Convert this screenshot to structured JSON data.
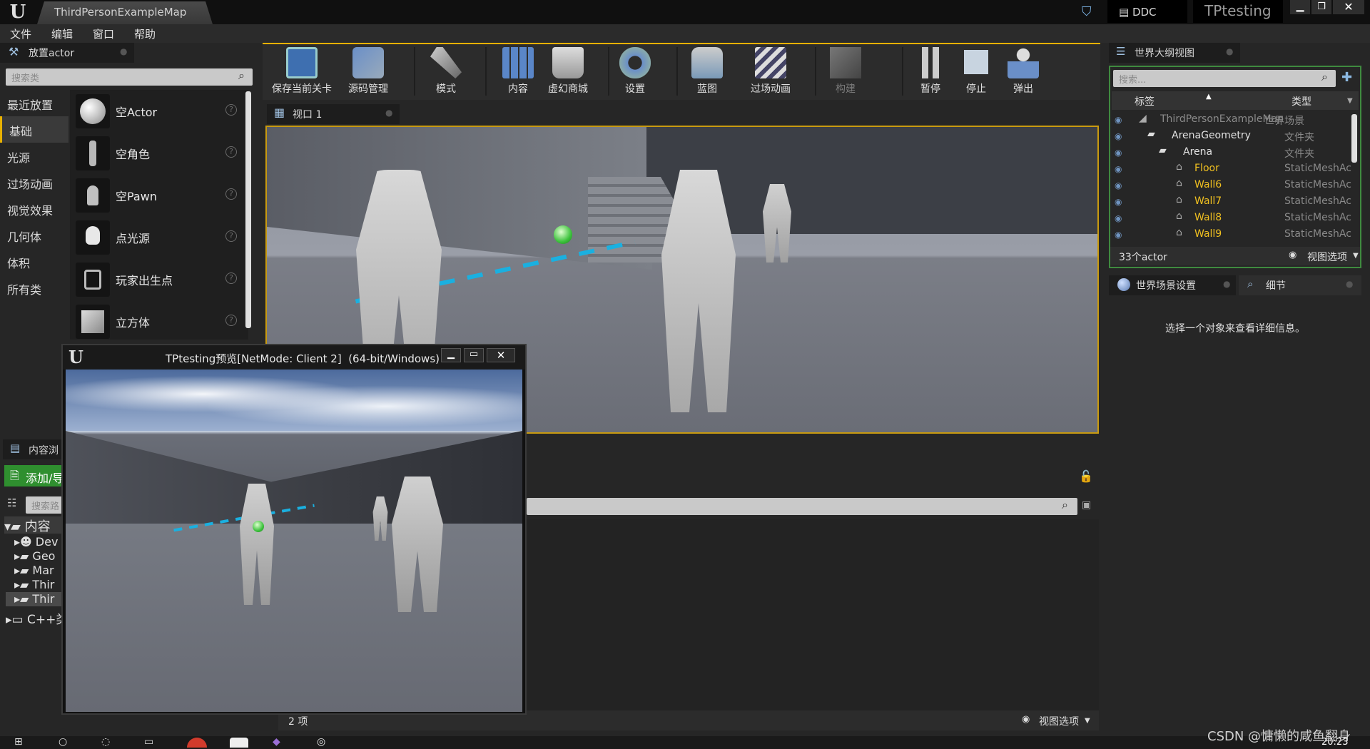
{
  "titlebar": {
    "map_tab": "ThirdPersonExampleMap",
    "ddc": "DDC",
    "project": "TPtesting"
  },
  "menu": [
    "文件",
    "编辑",
    "窗口",
    "帮助"
  ],
  "place_actor": {
    "title": "放置actor",
    "search_placeholder": "搜索类",
    "categories": [
      "最近放置",
      "基础",
      "光源",
      "过场动画",
      "视觉效果",
      "几何体",
      "体积",
      "所有类"
    ],
    "items": [
      "空Actor",
      "空角色",
      "空Pawn",
      "点光源",
      "玩家出生点",
      "立方体"
    ]
  },
  "toolbar": [
    "保存当前关卡",
    "源码管理",
    "模式",
    "内容",
    "虚幻商城",
    "设置",
    "蓝图",
    "过场动画",
    "构建",
    "暂停",
    "停止",
    "弹出"
  ],
  "viewport": {
    "tab": "视口 1"
  },
  "outliner": {
    "title": "世界大纲视图",
    "search_placeholder": "搜索...",
    "col_label": "标签",
    "col_type": "类型",
    "rows": [
      {
        "label": "ThirdPersonExampleMap",
        "type": "世界场景"
      },
      {
        "label": "ArenaGeometry",
        "type": "文件夹"
      },
      {
        "label": "Arena",
        "type": "文件夹"
      },
      {
        "label": "Floor",
        "type": "StaticMeshAc"
      },
      {
        "label": "Wall6",
        "type": "StaticMeshAc"
      },
      {
        "label": "Wall7",
        "type": "StaticMeshAc"
      },
      {
        "label": "Wall8",
        "type": "StaticMeshAc"
      },
      {
        "label": "Wall9",
        "type": "StaticMeshAc"
      }
    ],
    "count": "33个actor",
    "view_options": "视图选项"
  },
  "details": {
    "tab_world": "世界场景设置",
    "tab_details": "细节",
    "empty_msg": "选择一个对象来查看详细信息。"
  },
  "content_browser": {
    "tab": "内容浏",
    "add_btn": "添加/导",
    "search_placeholder": "搜索路",
    "tree": [
      "内容",
      "Dev",
      "Geo",
      "Mar",
      "Thir",
      "Thir",
      "C++类"
    ],
    "item_count": "2 项",
    "view_options": "视图选项"
  },
  "preview_window": {
    "title": "TPtesting预览[NetMode: Client 2]  (64-bit/Windows)"
  },
  "watermark": "CSDN @慵懒的咸鱼翻身",
  "clock": "20:23",
  "colors": {
    "accent": "#e8b100",
    "outliner_border": "#3f8a3f",
    "add_green": "#2f8f2f",
    "hyperlink_yellow": "#f0c020"
  }
}
